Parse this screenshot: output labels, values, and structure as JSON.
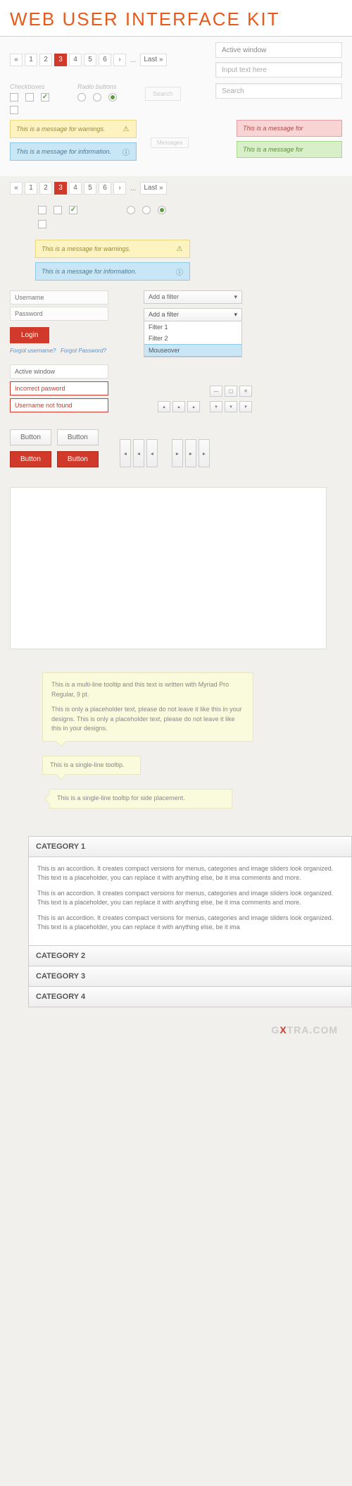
{
  "title": "WEB USER INTERFACE KIT",
  "pagination": {
    "first": "«",
    "prev": "‹",
    "pages": [
      "1",
      "2",
      "3",
      "4",
      "5",
      "6"
    ],
    "next": "›",
    "dots": "...",
    "last": "Last »",
    "active": "3"
  },
  "inputs": {
    "active_window": "Active window",
    "placeholder": "Input text here",
    "search": "Search",
    "search_btn": "Search"
  },
  "labels": {
    "checkboxes": "Checkboxes",
    "radio": "Radio buttons",
    "messages": "Messages"
  },
  "messages": {
    "warn": "This is a message for warnings.",
    "info": "This is a message for information.",
    "err": "This is a message for",
    "ok": "This is a message for"
  },
  "login": {
    "username": "Username",
    "password": "Password",
    "btn": "Login",
    "forgot_user": "Forgot username?",
    "forgot_pass": "Forgot Password?"
  },
  "dropdown": {
    "label": "Add a filter",
    "options": [
      "Filter 1",
      "Filter 2",
      "Mouseover"
    ]
  },
  "status": {
    "active": "Active window",
    "incorrect": "Incorrect pasword",
    "notfound": "Username not found"
  },
  "buttons": {
    "label": "Button"
  },
  "tooltips": {
    "multi_p1": "This is a multi-line tooltip and this text is written with Myriad Pro Regular, 9 pt.",
    "multi_p2": "This is only a placeholder text, please do not leave it like this in your designs. This is only a placeholder text, please do not leave it like this in your designs.",
    "single": "This is a single-line tooltip.",
    "side": "This is a single-line tooltip for side placement."
  },
  "accordion": {
    "cats": [
      "CATEGORY 1",
      "CATEGORY 2",
      "CATEGORY 3",
      "CATEGORY 4"
    ],
    "p1": "This is an accordion.  It creates compact versions for menus, categories and image sliders look organized. This text is a placeholder, you can replace it with anything else, be it ima comments and more.",
    "p2": "This is an accordion.  It creates compact versions for menus, categories and image sliders look organized. This text is a placeholder, you can replace it with anything else, be it ima comments and more.",
    "p3": "This is an accordion.  It creates compact versions for menus, categories and image sliders look organized. This text is a placeholder, you can replace it with anything else, be it ima"
  },
  "watermark": {
    "pre": "G",
    "x": "X",
    "post": "TRA.COM"
  }
}
